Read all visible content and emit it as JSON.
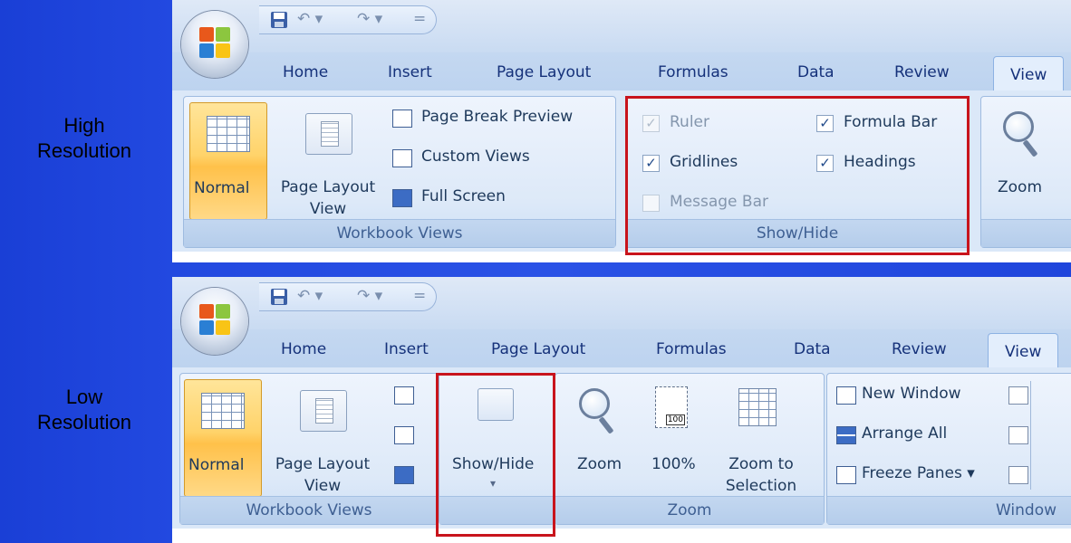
{
  "labels": {
    "high": [
      "High",
      "Resolution"
    ],
    "low": [
      "Low",
      "Resolution"
    ]
  },
  "tabs": [
    "Home",
    "Insert",
    "Page Layout",
    "Formulas",
    "Data",
    "Review",
    "View"
  ],
  "qat_symbols": {
    "undo": "↶ ▾",
    "redo": "↷ ▾",
    "more": "="
  },
  "high": {
    "workbook_views": {
      "normal": "Normal",
      "page_layout": [
        "Page Layout",
        "View"
      ],
      "page_break_preview": "Page Break Preview",
      "custom_views": "Custom Views",
      "full_screen": "Full Screen",
      "group_label": "Workbook Views"
    },
    "show_hide": {
      "ruler": "Ruler",
      "formula_bar": "Formula Bar",
      "gridlines": "Gridlines",
      "headings": "Headings",
      "message_bar": "Message Bar",
      "group_label": "Show/Hide",
      "checks": {
        "ruler": "✓",
        "formula_bar": "✓",
        "gridlines": "✓",
        "headings": "✓",
        "message_bar": ""
      }
    },
    "zoom_label": "Zoom"
  },
  "low": {
    "workbook_views": {
      "normal": "Normal",
      "page_layout": [
        "Page Layout",
        "View"
      ],
      "group_label": "Workbook Views"
    },
    "show_hide": {
      "label": "Show/Hide",
      "arrow": "▾"
    },
    "zoom": {
      "zoom": "Zoom",
      "hundred": "100%",
      "hundred_icon": "100",
      "zoom_to_selection": [
        "Zoom to",
        "Selection"
      ],
      "group_label": "Zoom"
    },
    "window": {
      "new_window": "New Window",
      "arrange_all": "Arrange All",
      "freeze_panes": "Freeze Panes ▾",
      "group_label": "Window"
    }
  },
  "colors": {
    "highlight": "#c8141c",
    "tab_text": "#15317a",
    "background": "#2249e0"
  }
}
